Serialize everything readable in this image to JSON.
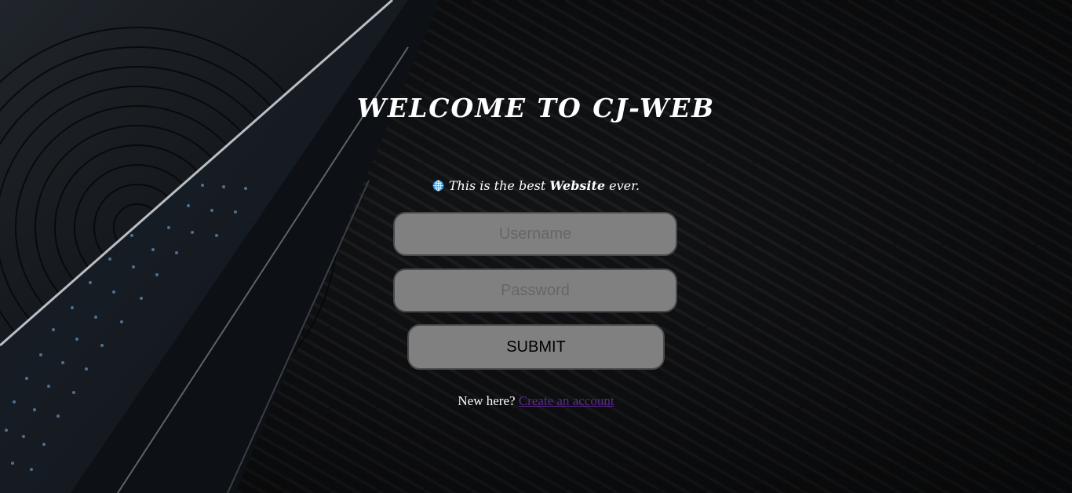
{
  "page": {
    "title": "WELCOME TO CJ-WEB"
  },
  "tagline": {
    "icon": "globe-icon",
    "prefix": "This is the best ",
    "emphasis": "Website",
    "suffix": " ever."
  },
  "form": {
    "username_placeholder": "Username",
    "password_placeholder": "Password",
    "submit_label": "SUBMIT"
  },
  "signup": {
    "prompt": "New here?",
    "link_label": "Create an account"
  },
  "colors": {
    "background": "#101113",
    "field": "#808080",
    "field_border": "#4a4a4a",
    "link": "#5b2a8f",
    "text": "#ffffff"
  }
}
